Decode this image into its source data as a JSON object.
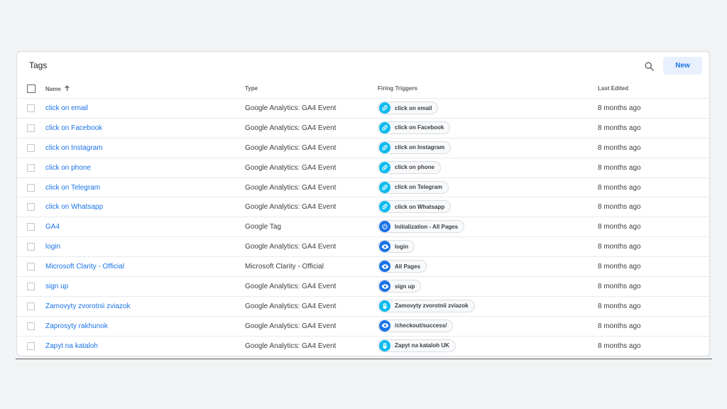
{
  "header": {
    "title": "Tags",
    "new_label": "New",
    "search_icon": "search-icon"
  },
  "columns": {
    "name": "Name",
    "type": "Type",
    "firing_triggers": "Firing Triggers",
    "last_edited": "Last Edited"
  },
  "colors": {
    "link": "#1a73e8",
    "click_trigger": "#0bbbef",
    "view_trigger": "#1a73e8",
    "button_bg": "#e8f0fe"
  },
  "rows": [
    {
      "name": "click on email",
      "type": "Google Analytics: GA4 Event",
      "trigger": "click on email",
      "trigger_icon": "link-icon",
      "trigger_color": "#0bbbef",
      "last_edited": "8 months ago"
    },
    {
      "name": "click on Facebook",
      "type": "Google Analytics: GA4 Event",
      "trigger": "click on Facebook",
      "trigger_icon": "link-icon",
      "trigger_color": "#0bbbef",
      "last_edited": "8 months ago"
    },
    {
      "name": "click on Instagram",
      "type": "Google Analytics: GA4 Event",
      "trigger": "click on Instagram",
      "trigger_icon": "link-icon",
      "trigger_color": "#0bbbef",
      "last_edited": "8 months ago"
    },
    {
      "name": "click on phone",
      "type": "Google Analytics: GA4 Event",
      "trigger": "click on phone",
      "trigger_icon": "link-icon",
      "trigger_color": "#0bbbef",
      "last_edited": "8 months ago"
    },
    {
      "name": "click on Telegram",
      "type": "Google Analytics: GA4 Event",
      "trigger": "click on Telegram",
      "trigger_icon": "link-icon",
      "trigger_color": "#0bbbef",
      "last_edited": "8 months ago"
    },
    {
      "name": "click on Whatsapp",
      "type": "Google Analytics: GA4 Event",
      "trigger": "click on Whatsapp",
      "trigger_icon": "link-icon",
      "trigger_color": "#0bbbef",
      "last_edited": "8 months ago"
    },
    {
      "name": "GA4",
      "type": "Google Tag",
      "trigger": "Initialization - All Pages",
      "trigger_icon": "power-icon",
      "trigger_color": "#1a73e8",
      "last_edited": "8 months ago"
    },
    {
      "name": "login",
      "type": "Google Analytics: GA4 Event",
      "trigger": "login",
      "trigger_icon": "eye-icon",
      "trigger_color": "#1a73e8",
      "last_edited": "8 months ago"
    },
    {
      "name": "Microsoft Clarity - Official",
      "type": "Microsoft Clarity - Official",
      "trigger": "All Pages",
      "trigger_icon": "eye-icon",
      "trigger_color": "#1a73e8",
      "last_edited": "8 months ago"
    },
    {
      "name": "sign up",
      "type": "Google Analytics: GA4 Event",
      "trigger": "sign up",
      "trigger_icon": "eye-icon",
      "trigger_color": "#1a73e8",
      "last_edited": "8 months ago"
    },
    {
      "name": "Zamovyty zvorotnii zviazok",
      "type": "Google Analytics: GA4 Event",
      "trigger": "Zamovyty zvorotnii zviazok",
      "trigger_icon": "mouse-icon",
      "trigger_color": "#0bbbef",
      "last_edited": "8 months ago"
    },
    {
      "name": "Zaprosyty rakhunok",
      "type": "Google Analytics: GA4 Event",
      "trigger": "/checkout/success/",
      "trigger_icon": "eye-icon",
      "trigger_color": "#1a73e8",
      "last_edited": "8 months ago"
    },
    {
      "name": "Zapyt na kataloh",
      "type": "Google Analytics: GA4 Event",
      "trigger": "Zapyt na kataloh UK",
      "trigger_icon": "mouse-icon",
      "trigger_color": "#0bbbef",
      "last_edited": "8 months ago"
    }
  ]
}
